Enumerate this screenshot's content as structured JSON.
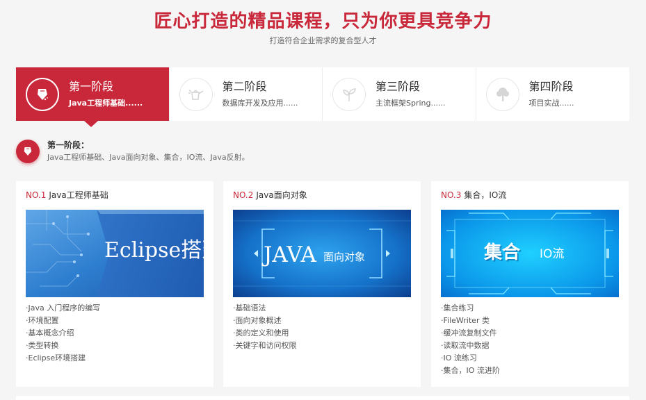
{
  "header": {
    "title": "匠心打造的精品课程，只为你更具竞争力",
    "subtitle": "打造符合企业需求的复合型人才"
  },
  "tabs": [
    {
      "name": "第一阶段",
      "desc": "Java工程师基础......",
      "icon": "pencil-icon",
      "active": true
    },
    {
      "name": "第二阶段",
      "desc": "数据库开发及应用......",
      "icon": "watering-can-icon",
      "active": false
    },
    {
      "name": "第三阶段",
      "desc": "主流框架Spring......",
      "icon": "sprout-icon",
      "active": false
    },
    {
      "name": "第四阶段",
      "desc": "项目实战......",
      "icon": "tree-icon",
      "active": false
    }
  ],
  "stage": {
    "title": "第一阶段：",
    "desc": "Java工程师基础、Java面向对象、集合，IO流、Java反射。",
    "icon": "pencil-icon"
  },
  "cards": [
    {
      "no": "NO.1",
      "name": "Java工程师基础",
      "image_text": "Eclipse搭建",
      "items": [
        "·Java 入门程序的编写",
        "·环境配置",
        "·基本概念介绍",
        "·类型转换",
        "·Eclipse环境搭建"
      ]
    },
    {
      "no": "NO.2",
      "name": "Java面向对象",
      "image_text_main": "JAVA",
      "image_text_sub": "面向对象",
      "items": [
        "·基础语法",
        "·面向对象概述",
        "·类的定义和使用",
        "·关键字和访问权限"
      ]
    },
    {
      "no": "NO.3",
      "name": "集合，IO流",
      "image_text_main": "集合",
      "image_text_sub": "IO流",
      "items": [
        "·集合练习",
        "·FileWriter 类",
        "·缓冲流复制文件",
        "·读取流中数据",
        "·IO 流练习",
        "·集合，IO 流进阶"
      ]
    }
  ],
  "colors": {
    "accent": "#c8283a",
    "card_bg": "#ffffff",
    "page_bg": "#f5f5f5"
  }
}
